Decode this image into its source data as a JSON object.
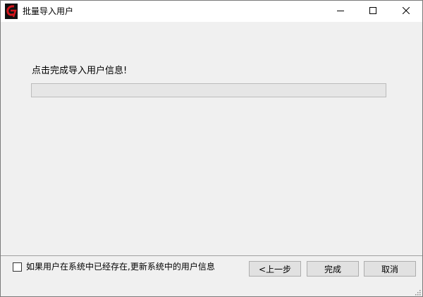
{
  "window": {
    "title": "批量导入用户",
    "icon": "app-logo-icon",
    "controls": [
      "minimize-icon",
      "maximize-icon",
      "close-icon"
    ]
  },
  "main": {
    "message": "点击完成导入用户信息!",
    "progress": {
      "value": 0
    }
  },
  "footer": {
    "update_existing_label": "如果用户在系统中已经存在,更新系统中的用户信息",
    "update_existing_checked": false,
    "back_label": "<上一步",
    "finish_label": "完成",
    "cancel_label": "取消"
  },
  "colors": {
    "window_bg": "#f0f0f0",
    "titlebar_bg": "#ffffff",
    "progress_fill": "#06b025",
    "logo_red": "#d4141b"
  }
}
